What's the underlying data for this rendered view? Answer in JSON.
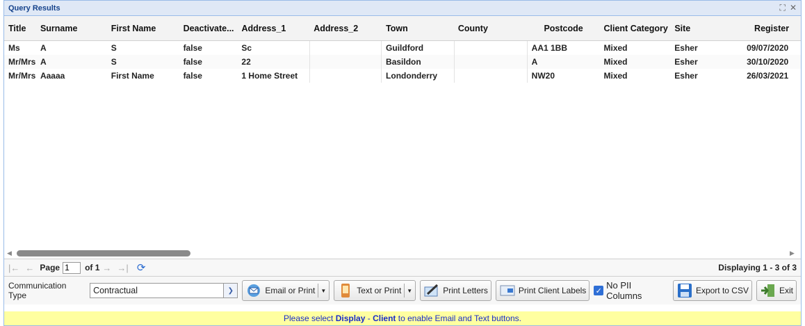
{
  "window": {
    "title": "Query Results"
  },
  "columns": [
    {
      "key": "title",
      "label": "Title",
      "width": 46
    },
    {
      "key": "surname",
      "label": "Surname",
      "width": 102
    },
    {
      "key": "first_name",
      "label": "First Name",
      "width": 104
    },
    {
      "key": "deactivated",
      "label": "Deactivate...",
      "width": 84
    },
    {
      "key": "address1",
      "label": "Address_1",
      "width": 104
    },
    {
      "key": "address2",
      "label": "Address_2",
      "width": 104
    },
    {
      "key": "town",
      "label": "Town",
      "width": 104
    },
    {
      "key": "county",
      "label": "County",
      "width": 106
    },
    {
      "key": "postcode",
      "label": "Postcode",
      "width": 104
    },
    {
      "key": "client_category",
      "label": "Client Category",
      "width": 102
    },
    {
      "key": "site",
      "label": "Site",
      "width": 104
    },
    {
      "key": "register",
      "label": "Register",
      "width": 84
    }
  ],
  "rows": [
    {
      "title": "Ms",
      "surname": "A",
      "first_name": "S",
      "deactivated": "false",
      "address1": "Sc",
      "address2": "",
      "town": "Guildford",
      "county": "",
      "postcode": "AA1 1BB",
      "client_category": "Mixed",
      "site": "Esher",
      "register": "09/07/2020"
    },
    {
      "title": "Mr/Mrs",
      "surname": "A",
      "first_name": "S",
      "deactivated": "false",
      "address1": "22",
      "address2": "",
      "town": "Basildon",
      "county": "",
      "postcode": "A",
      "client_category": "Mixed",
      "site": "Esher",
      "register": "30/10/2020"
    },
    {
      "title": "Mr/Mrs",
      "surname": "Aaaaa",
      "first_name": "First Name",
      "deactivated": "false",
      "address1": "1 Home Street",
      "address2": "",
      "town": "Londonderry",
      "county": "",
      "postcode": "NW20",
      "client_category": "Mixed",
      "site": "Esher",
      "register": "26/03/2021"
    }
  ],
  "pager": {
    "page_label": "Page",
    "page_value": "1",
    "of_label": "of 1",
    "displaying": "Displaying 1 - 3 of 3"
  },
  "toolbar": {
    "comm_label": "Communication Type",
    "comm_value": "Contractual",
    "email_label": "Email or Print",
    "text_label": "Text or Print",
    "letters_label": "Print Letters",
    "labels_label": "Print Client Labels",
    "nopii_label": "No PII Columns",
    "csv_label": "Export to CSV",
    "exit_label": "Exit"
  },
  "status": {
    "prefix": "Please select ",
    "display": "Display",
    "sep": " - ",
    "client": "Client",
    "suffix": " to enable Email and Text buttons."
  },
  "colors": {
    "status_bg": "#ffffa0",
    "status_text": "#1a2dc7",
    "header_bg": "#dfe8f6"
  }
}
